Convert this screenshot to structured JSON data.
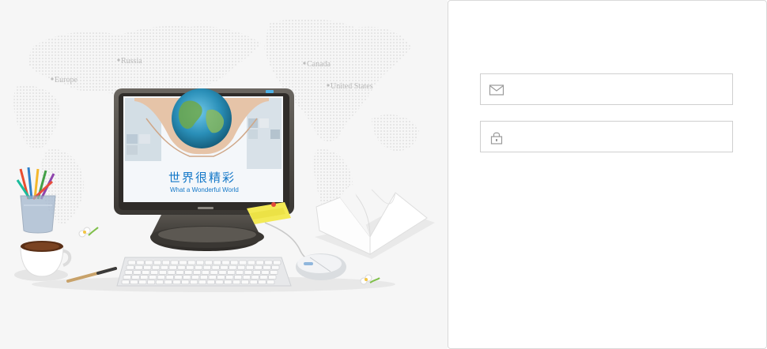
{
  "hero": {
    "map_labels": {
      "russia": "Russia",
      "europe": "Europe",
      "canada": "Canada",
      "united_states": "United  States"
    },
    "screen_title": "世界很精彩",
    "screen_subtitle": "What a Wonderful World"
  },
  "login": {
    "email": {
      "icon": "envelope-icon",
      "value": "",
      "placeholder": ""
    },
    "password": {
      "icon": "lock-icon",
      "value": "",
      "placeholder": ""
    }
  }
}
